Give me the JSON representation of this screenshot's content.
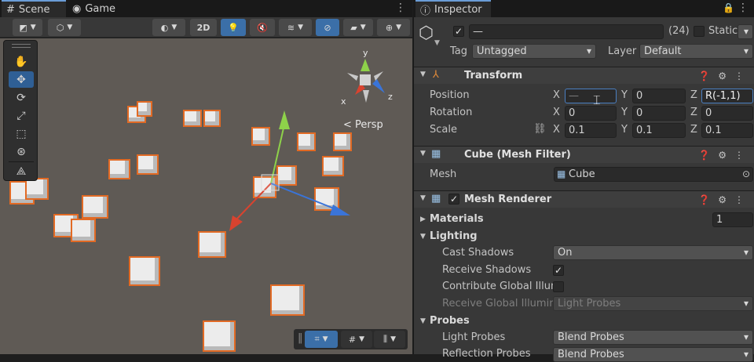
{
  "scene_tabs": [
    {
      "label": "Scene",
      "icon": "grid-icon"
    },
    {
      "label": "Game",
      "icon": "gamepad-icon"
    }
  ],
  "scene_toolbar": {
    "btn_2d": "2D"
  },
  "viewport": {
    "persp_label": "< Persp",
    "gizmo_axes": {
      "x": "x",
      "y": "y",
      "z": "z"
    }
  },
  "inspector": {
    "tab_label": "Inspector",
    "object": {
      "name_value": "—",
      "count": "(24)",
      "static_label": "Static",
      "tag_label": "Tag",
      "tag_value": "Untagged",
      "layer_label": "Layer",
      "layer_value": "Default"
    },
    "transform": {
      "title": "Transform",
      "position_label": "Position",
      "rotation_label": "Rotation",
      "scale_label": "Scale",
      "position": {
        "x": "—",
        "y": "0",
        "z": "R(-1,1)"
      },
      "rotation": {
        "x": "0",
        "y": "0",
        "z": "0"
      },
      "scale": {
        "x": "0.1",
        "y": "0.1",
        "z": "0.1"
      },
      "axis_x": "X",
      "axis_y": "Y",
      "axis_z": "Z"
    },
    "mesh_filter": {
      "title": "Cube (Mesh Filter)",
      "mesh_label": "Mesh",
      "mesh_value": "Cube"
    },
    "mesh_renderer": {
      "title": "Mesh Renderer",
      "materials_label": "Materials",
      "materials_count": "1",
      "lighting_label": "Lighting",
      "cast_shadows_label": "Cast Shadows",
      "cast_shadows_value": "On",
      "receive_shadows_label": "Receive Shadows",
      "contribute_gi_label": "Contribute Global Illum",
      "receive_gi_label": "Receive Global Illumina",
      "receive_gi_value": "Light Probes",
      "probes_label": "Probes",
      "light_probes_label": "Light Probes",
      "light_probes_value": "Blend Probes",
      "reflection_probes_label": "Reflection Probes",
      "reflection_probes_value": "Blend Probes"
    }
  },
  "colors": {
    "accent": "#3b6fa8",
    "selection_outline": "#e26a24",
    "axis_x": "#d9432f",
    "axis_y": "#8ed14a",
    "axis_z": "#3a74d8"
  }
}
